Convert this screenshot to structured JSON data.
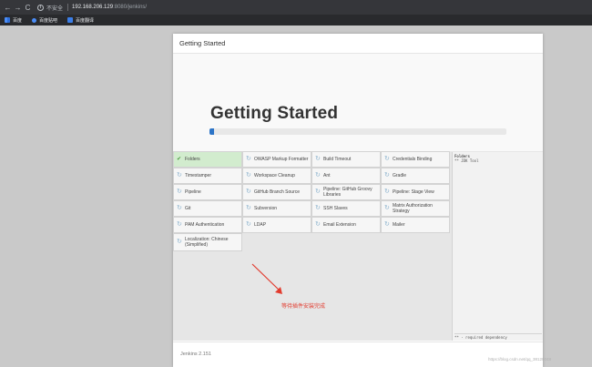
{
  "browser": {
    "back_glyph": "←",
    "forward_glyph": "→",
    "reload_glyph": "C",
    "info_glyph": "i",
    "insecure_label": "不安全",
    "url_host": "192.168.206.129",
    "url_rest": ":8080/jenkins/",
    "bookmarks": [
      {
        "label": "百度",
        "icon": "apps-grid-icon"
      },
      {
        "label": "百度贴吧",
        "icon": "baidu-paw-icon"
      },
      {
        "label": "百度翻译",
        "icon": "translate-icon"
      }
    ]
  },
  "panel": {
    "header_title": "Getting Started",
    "hero_title": "Getting Started",
    "progress_fraction": 0.015,
    "progress_color": "#2c74c7"
  },
  "plugins": [
    {
      "name": "Folders",
      "status": "done"
    },
    {
      "name": "OWASP Markup Formatter",
      "status": "pending"
    },
    {
      "name": "Build Timeout",
      "status": "pending"
    },
    {
      "name": "Credentials Binding",
      "status": "pending"
    },
    {
      "name": "Timestamper",
      "status": "pending"
    },
    {
      "name": "Workspace Cleanup",
      "status": "pending"
    },
    {
      "name": "Ant",
      "status": "pending"
    },
    {
      "name": "Gradle",
      "status": "pending"
    },
    {
      "name": "Pipeline",
      "status": "pending"
    },
    {
      "name": "GitHub Branch Source",
      "status": "pending"
    },
    {
      "name": "Pipeline: GitHub Groovy Libraries",
      "status": "pending"
    },
    {
      "name": "Pipeline: Stage View",
      "status": "pending"
    },
    {
      "name": "Git",
      "status": "pending"
    },
    {
      "name": "Subversion",
      "status": "pending"
    },
    {
      "name": "SSH Slaves",
      "status": "pending"
    },
    {
      "name": "Matrix Authorization Strategy",
      "status": "pending"
    },
    {
      "name": "PAM Authentication",
      "status": "pending"
    },
    {
      "name": "LDAP",
      "status": "pending"
    },
    {
      "name": "Email Extension",
      "status": "pending"
    },
    {
      "name": "Mailer",
      "status": "pending"
    },
    {
      "name": "Localization: Chinese (Simplified)",
      "status": "pending"
    }
  ],
  "status_glyphs": {
    "done": "✔",
    "pending": "↻"
  },
  "status_colors": {
    "done": "#d2ecce",
    "pending": "#f6f6f6"
  },
  "side_log": {
    "line1": "Folders",
    "line2": "** JDK Tool",
    "footer": "** - required dependency"
  },
  "annotation": {
    "text": "等待插件安装完成",
    "color": "#e23b2e"
  },
  "footer": {
    "version": "Jenkins 2.151"
  },
  "watermark": "https://blog.csdn.net/qq_38120048"
}
